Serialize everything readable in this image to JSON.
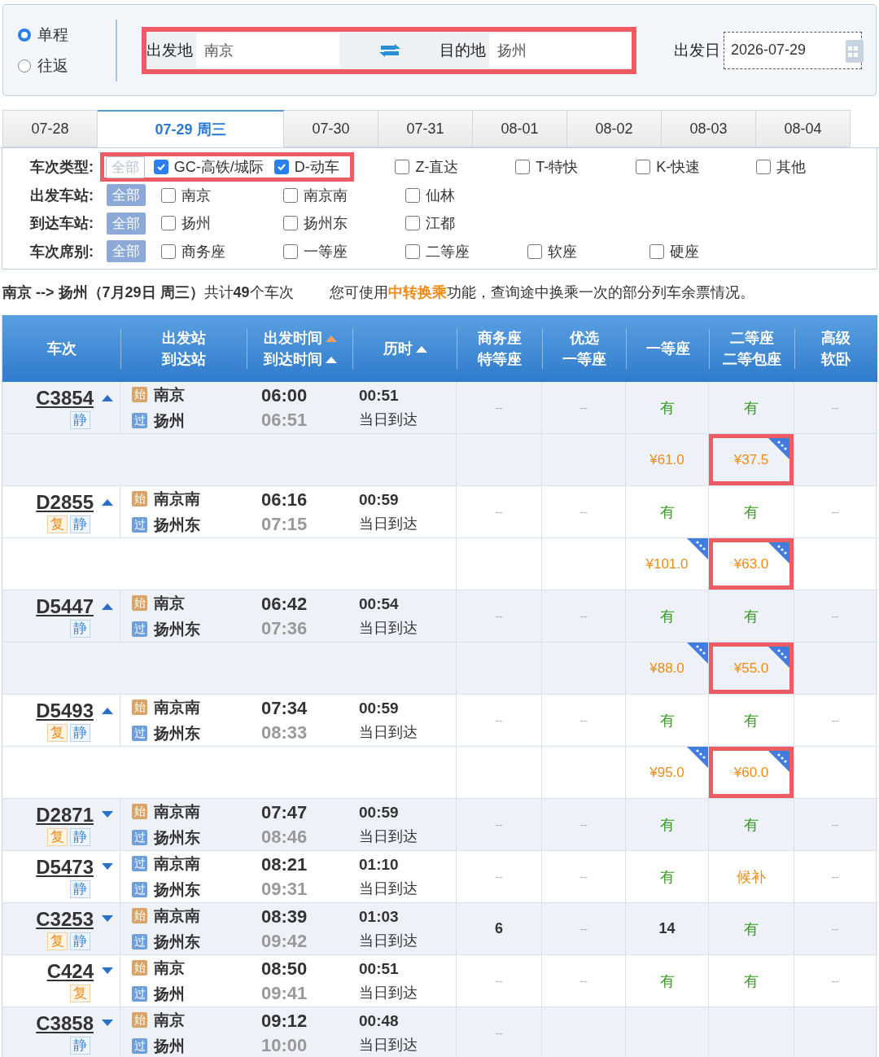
{
  "trip_type": [
    {
      "label": "单程",
      "selected": true
    },
    {
      "label": "往返",
      "selected": false
    }
  ],
  "search": {
    "highlighted": true,
    "from_label": "出发地",
    "from_value": "南京",
    "to_label": "目的地",
    "to_value": "扬州",
    "date_label": "出发日",
    "date_value": "2026-07-29"
  },
  "date_tabs": [
    {
      "label": "07-28",
      "selected": false
    },
    {
      "label": "07-29 周三",
      "selected": true
    },
    {
      "label": "07-30",
      "selected": false
    },
    {
      "label": "07-31",
      "selected": false
    },
    {
      "label": "08-01",
      "selected": false
    },
    {
      "label": "08-02",
      "selected": false
    },
    {
      "label": "08-03",
      "selected": false
    },
    {
      "label": "08-04",
      "selected": false
    }
  ],
  "filters": [
    {
      "label": "车次类型:",
      "all_label": "全部",
      "all_selected": false,
      "all_highlighted": true,
      "options": [
        {
          "label": "GC-高铁/城际",
          "checked": true,
          "highlighted": true
        },
        {
          "label": "D-动车",
          "checked": true,
          "highlighted": true
        },
        {
          "label": "Z-直达",
          "checked": false,
          "highlighted": false
        },
        {
          "label": "T-特快",
          "checked": false,
          "highlighted": false
        },
        {
          "label": "K-快速",
          "checked": false,
          "highlighted": false
        },
        {
          "label": "其他",
          "checked": false,
          "highlighted": false
        }
      ]
    },
    {
      "label": "出发车站:",
      "all_label": "全部",
      "all_selected": true,
      "all_highlighted": false,
      "options": [
        {
          "label": "南京",
          "checked": false,
          "highlighted": false
        },
        {
          "label": "南京南",
          "checked": false,
          "highlighted": false
        },
        {
          "label": "仙林",
          "checked": false,
          "highlighted": false
        }
      ]
    },
    {
      "label": "到达车站:",
      "all_label": "全部",
      "all_selected": true,
      "all_highlighted": false,
      "options": [
        {
          "label": "扬州",
          "checked": false,
          "highlighted": false
        },
        {
          "label": "扬州东",
          "checked": false,
          "highlighted": false
        },
        {
          "label": "江都",
          "checked": false,
          "highlighted": false
        }
      ]
    },
    {
      "label": "车次席别:",
      "all_label": "全部",
      "all_selected": true,
      "all_highlighted": false,
      "options": [
        {
          "label": "商务座",
          "checked": false,
          "highlighted": false
        },
        {
          "label": "一等座",
          "checked": false,
          "highlighted": false
        },
        {
          "label": "二等座",
          "checked": false,
          "highlighted": false
        },
        {
          "label": "软座",
          "checked": false,
          "highlighted": false
        },
        {
          "label": "硬座",
          "checked": false,
          "highlighted": false
        }
      ]
    }
  ],
  "summary": {
    "text": "**南京 --> 扬州（7月29日  周三）**共计**49**个车次",
    "notice_before": "您可使用",
    "notice_link": "中转换乘",
    "notice_after": "功能，查询途中换乘一次的部分列车余票情况。"
  },
  "columns": [
    {
      "lines": [
        "车次"
      ]
    },
    {
      "lines": [
        "出发站",
        "到达站"
      ]
    },
    {
      "lines": [
        "出发时间",
        "到达时间"
      ],
      "sort_active": [
        true,
        false
      ]
    },
    {
      "lines": [
        "历时"
      ],
      "sort_active": [
        false
      ]
    },
    {
      "lines": [
        "商务座",
        "特等座"
      ]
    },
    {
      "lines": [
        "优选",
        "一等座"
      ]
    },
    {
      "lines": [
        "一等座"
      ]
    },
    {
      "lines": [
        "二等座",
        "二等包座"
      ]
    },
    {
      "lines": [
        "高级",
        "软卧"
      ]
    }
  ],
  "rows": [
    {
      "train": "C3854",
      "expanded": true,
      "badges": [
        {
          "text": "静",
          "kind": "quiet"
        }
      ],
      "from_tag": "始",
      "from_origin": true,
      "from": "南京",
      "to_tag": "过",
      "to_origin": false,
      "to": "扬州",
      "depart": "06:00",
      "arrive": "06:51",
      "duration": "00:51",
      "arrival_day": "当日到达",
      "seats": [
        {
          "text": "--",
          "kind": "none"
        },
        {
          "text": "--",
          "kind": "none"
        },
        {
          "text": "有",
          "kind": "available"
        },
        {
          "text": "有",
          "kind": "available"
        },
        {
          "text": "--",
          "kind": "none"
        }
      ],
      "prices": {
        "first": {
          "text": "¥61.0",
          "discount": false,
          "highlighted": false
        },
        "second": {
          "text": "¥37.5",
          "discount": true,
          "highlighted": true
        }
      }
    },
    {
      "train": "D2855",
      "expanded": true,
      "badges": [
        {
          "text": "复",
          "kind": "resale"
        },
        {
          "text": "静",
          "kind": "quiet"
        }
      ],
      "from_tag": "始",
      "from_origin": true,
      "from": "南京南",
      "to_tag": "过",
      "to_origin": false,
      "to": "扬州东",
      "depart": "06:16",
      "arrive": "07:15",
      "duration": "00:59",
      "arrival_day": "当日到达",
      "seats": [
        {
          "text": "--",
          "kind": "none"
        },
        {
          "text": "--",
          "kind": "none"
        },
        {
          "text": "有",
          "kind": "available"
        },
        {
          "text": "有",
          "kind": "available"
        },
        {
          "text": "--",
          "kind": "none"
        }
      ],
      "prices": {
        "first": {
          "text": "¥101.0",
          "discount": true,
          "highlighted": false
        },
        "second": {
          "text": "¥63.0",
          "discount": true,
          "highlighted": true
        }
      }
    },
    {
      "train": "D5447",
      "expanded": true,
      "badges": [
        {
          "text": "静",
          "kind": "quiet"
        }
      ],
      "from_tag": "始",
      "from_origin": true,
      "from": "南京",
      "to_tag": "过",
      "to_origin": false,
      "to": "扬州东",
      "depart": "06:42",
      "arrive": "07:36",
      "duration": "00:54",
      "arrival_day": "当日到达",
      "seats": [
        {
          "text": "--",
          "kind": "none"
        },
        {
          "text": "--",
          "kind": "none"
        },
        {
          "text": "有",
          "kind": "available"
        },
        {
          "text": "有",
          "kind": "available"
        },
        {
          "text": "--",
          "kind": "none"
        }
      ],
      "prices": {
        "first": {
          "text": "¥88.0",
          "discount": true,
          "highlighted": false
        },
        "second": {
          "text": "¥55.0",
          "discount": true,
          "highlighted": true
        }
      }
    },
    {
      "train": "D5493",
      "expanded": true,
      "badges": [
        {
          "text": "复",
          "kind": "resale"
        },
        {
          "text": "静",
          "kind": "quiet"
        }
      ],
      "from_tag": "始",
      "from_origin": true,
      "from": "南京南",
      "to_tag": "过",
      "to_origin": false,
      "to": "扬州东",
      "depart": "07:34",
      "arrive": "08:33",
      "duration": "00:59",
      "arrival_day": "当日到达",
      "seats": [
        {
          "text": "--",
          "kind": "none"
        },
        {
          "text": "--",
          "kind": "none"
        },
        {
          "text": "有",
          "kind": "available"
        },
        {
          "text": "有",
          "kind": "available"
        },
        {
          "text": "--",
          "kind": "none"
        }
      ],
      "prices": {
        "first": {
          "text": "¥95.0",
          "discount": true,
          "highlighted": false
        },
        "second": {
          "text": "¥60.0",
          "discount": true,
          "highlighted": true
        }
      }
    },
    {
      "train": "D2871",
      "expanded": false,
      "badges": [
        {
          "text": "复",
          "kind": "resale"
        },
        {
          "text": "静",
          "kind": "quiet"
        }
      ],
      "from_tag": "始",
      "from_origin": true,
      "from": "南京南",
      "to_tag": "过",
      "to_origin": false,
      "to": "扬州东",
      "depart": "07:47",
      "arrive": "08:46",
      "duration": "00:59",
      "arrival_day": "当日到达",
      "seats": [
        {
          "text": "--",
          "kind": "none"
        },
        {
          "text": "--",
          "kind": "none"
        },
        {
          "text": "有",
          "kind": "available"
        },
        {
          "text": "有",
          "kind": "available"
        },
        {
          "text": "--",
          "kind": "none"
        }
      ]
    },
    {
      "train": "D5473",
      "expanded": false,
      "badges": [
        {
          "text": "静",
          "kind": "quiet"
        }
      ],
      "from_tag": "过",
      "from_origin": false,
      "from": "南京南",
      "to_tag": "过",
      "to_origin": false,
      "to": "扬州东",
      "depart": "08:21",
      "arrive": "09:31",
      "duration": "01:10",
      "arrival_day": "当日到达",
      "seats": [
        {
          "text": "--",
          "kind": "none"
        },
        {
          "text": "--",
          "kind": "none"
        },
        {
          "text": "有",
          "kind": "available"
        },
        {
          "text": "候补",
          "kind": "waitlist"
        },
        {
          "text": "--",
          "kind": "none"
        }
      ]
    },
    {
      "train": "C3253",
      "expanded": false,
      "badges": [
        {
          "text": "复",
          "kind": "resale"
        },
        {
          "text": "静",
          "kind": "quiet"
        }
      ],
      "from_tag": "始",
      "from_origin": true,
      "from": "南京南",
      "to_tag": "过",
      "to_origin": false,
      "to": "扬州东",
      "depart": "08:39",
      "arrive": "09:42",
      "duration": "01:03",
      "arrival_day": "当日到达",
      "seats": [
        {
          "text": "6",
          "kind": "count"
        },
        {
          "text": "--",
          "kind": "none"
        },
        {
          "text": "14",
          "kind": "count"
        },
        {
          "text": "有",
          "kind": "available"
        },
        {
          "text": "--",
          "kind": "none"
        }
      ]
    },
    {
      "train": "C424",
      "expanded": false,
      "badges": [
        {
          "text": "复",
          "kind": "resale"
        }
      ],
      "from_tag": "始",
      "from_origin": true,
      "from": "南京",
      "to_tag": "过",
      "to_origin": false,
      "to": "扬州",
      "depart": "08:50",
      "arrive": "09:41",
      "duration": "00:51",
      "arrival_day": "当日到达",
      "seats": [
        {
          "text": "--",
          "kind": "none"
        },
        {
          "text": "--",
          "kind": "none"
        },
        {
          "text": "有",
          "kind": "available"
        },
        {
          "text": "有",
          "kind": "available"
        },
        {
          "text": "--",
          "kind": "none"
        }
      ]
    },
    {
      "train": "C3858",
      "expanded": false,
      "badges": [
        {
          "text": "静",
          "kind": "quiet"
        }
      ],
      "from_tag": "始",
      "from_origin": true,
      "from": "南京",
      "to_tag": "过",
      "to_origin": false,
      "to": "扬州",
      "depart": "09:12",
      "arrive": "10:00",
      "duration": "00:48",
      "arrival_day": "当日到达",
      "seats": [
        {
          "text": "--",
          "kind": "none"
        }
      ]
    }
  ]
}
